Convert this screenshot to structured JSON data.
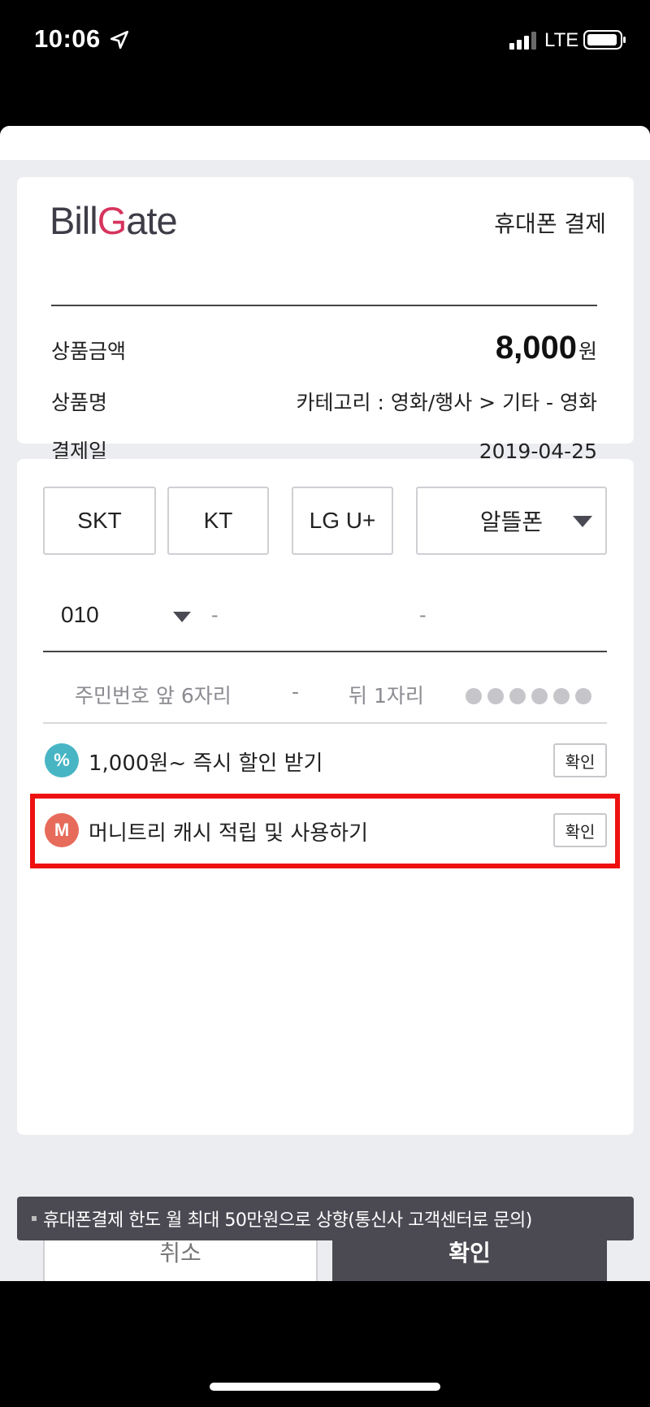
{
  "status_bar": {
    "time": "10:06",
    "network": "LTE"
  },
  "header": {
    "logo_part1": "Bill",
    "logo_part2": "G",
    "logo_part3": "ate",
    "title": "휴대폰 결제"
  },
  "info": {
    "amount_label": "상품금액",
    "amount_value": "8,000",
    "amount_unit": "원",
    "product_label": "상품명",
    "product_value": "카테고리 : 영화/행사 > 기타 - 영화",
    "date_label": "결제일",
    "date_value": "2019-04-25"
  },
  "carriers": [
    "SKT",
    "KT",
    "LG U+",
    "알뜰폰"
  ],
  "phone": {
    "prefix": "010",
    "sep1": "-",
    "sep2": "-"
  },
  "id_field": {
    "front_placeholder": "주민번호 앞 6자리",
    "sep": "-",
    "back_placeholder": "뒤 1자리"
  },
  "options": [
    {
      "icon": "%",
      "text": "1,000원~ 즉시 할인 받기",
      "button": "확인"
    },
    {
      "icon": "M",
      "text": "머니트리 캐시 적립 및 사용하기",
      "button": "확인"
    }
  ],
  "actions": {
    "cancel": "취소",
    "confirm": "확인"
  },
  "notice": "휴대폰결제 한도 월 최대 50만원으로 상향(통신사 고객센터로 문의)",
  "colors": {
    "brand_red": "#d6345d",
    "dark_button": "#4b4a53",
    "discount_icon": "#47b5c4",
    "moneytree_icon": "#e76b5b",
    "highlight": "#ee1111"
  }
}
